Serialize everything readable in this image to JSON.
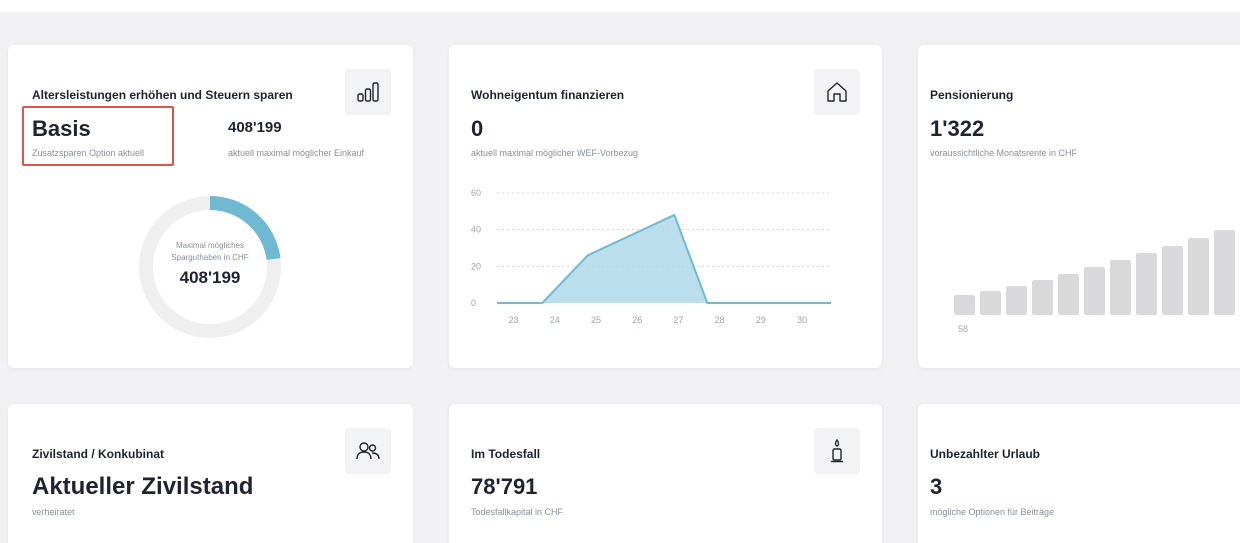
{
  "cards": [
    {
      "title": "Altersleistungen erhöhen und Steuern sparen",
      "value": "Basis",
      "sub": "Zusatzsparen Option aktuell",
      "value2": "408'199",
      "sub2": "aktuell maximal möglicher Einkauf",
      "icon": "bar-chart-icon",
      "ring": {
        "line1": "Maximal mögliches",
        "line2": "Sparguthaben in CHF",
        "value": "408'199",
        "fill_fraction": 0.23
      }
    },
    {
      "title": "Wohneigentum finanzieren",
      "value": "0",
      "sub": "aktuell maximal möglicher WEF-Vorbezug",
      "icon": "house-icon"
    },
    {
      "title": "Pensionierung",
      "value": "1'322",
      "sub": "voraussichtliche Monatsrente in CHF",
      "bar_label": "58"
    },
    {
      "title": "Zivilstand / Konkubinat",
      "value": "Aktueller Zivilstand",
      "sub": "verheiratet",
      "icon": "people-icon"
    },
    {
      "title": "Im Todesfall",
      "value": "78'791",
      "sub": "Todesfallkapital in CHF",
      "icon": "candle-icon"
    },
    {
      "title": "Unbezahlter Urlaub",
      "value": "3",
      "sub": "mögliche Optionen für Beiträge"
    }
  ],
  "colors": {
    "accent": "#6fb9d3",
    "area_fill": "#a9d6e6",
    "highlight": "#e0524a",
    "ring_track": "#efefef",
    "bar_gray": "#d9d9db"
  },
  "chart_data": [
    {
      "type": "area",
      "x": [
        "22.6",
        "23.7",
        "24.8",
        "26.9",
        "27.7",
        "30.7"
      ],
      "y": [
        0,
        0,
        26,
        48,
        0,
        0
      ],
      "xticks": [
        "23",
        "24",
        "25",
        "26",
        "27",
        "28",
        "29",
        "30"
      ],
      "yticks": [
        "0",
        "20",
        "40",
        "60"
      ],
      "ylim": [
        0,
        60
      ],
      "xlim": [
        22.6,
        30.7
      ],
      "grid": true
    },
    {
      "type": "bar",
      "values": [
        1,
        1.2,
        1.45,
        1.75,
        2.05,
        2.4,
        2.75,
        3.1,
        3.45,
        3.85,
        4.25
      ],
      "ticks": [
        "58"
      ]
    }
  ]
}
